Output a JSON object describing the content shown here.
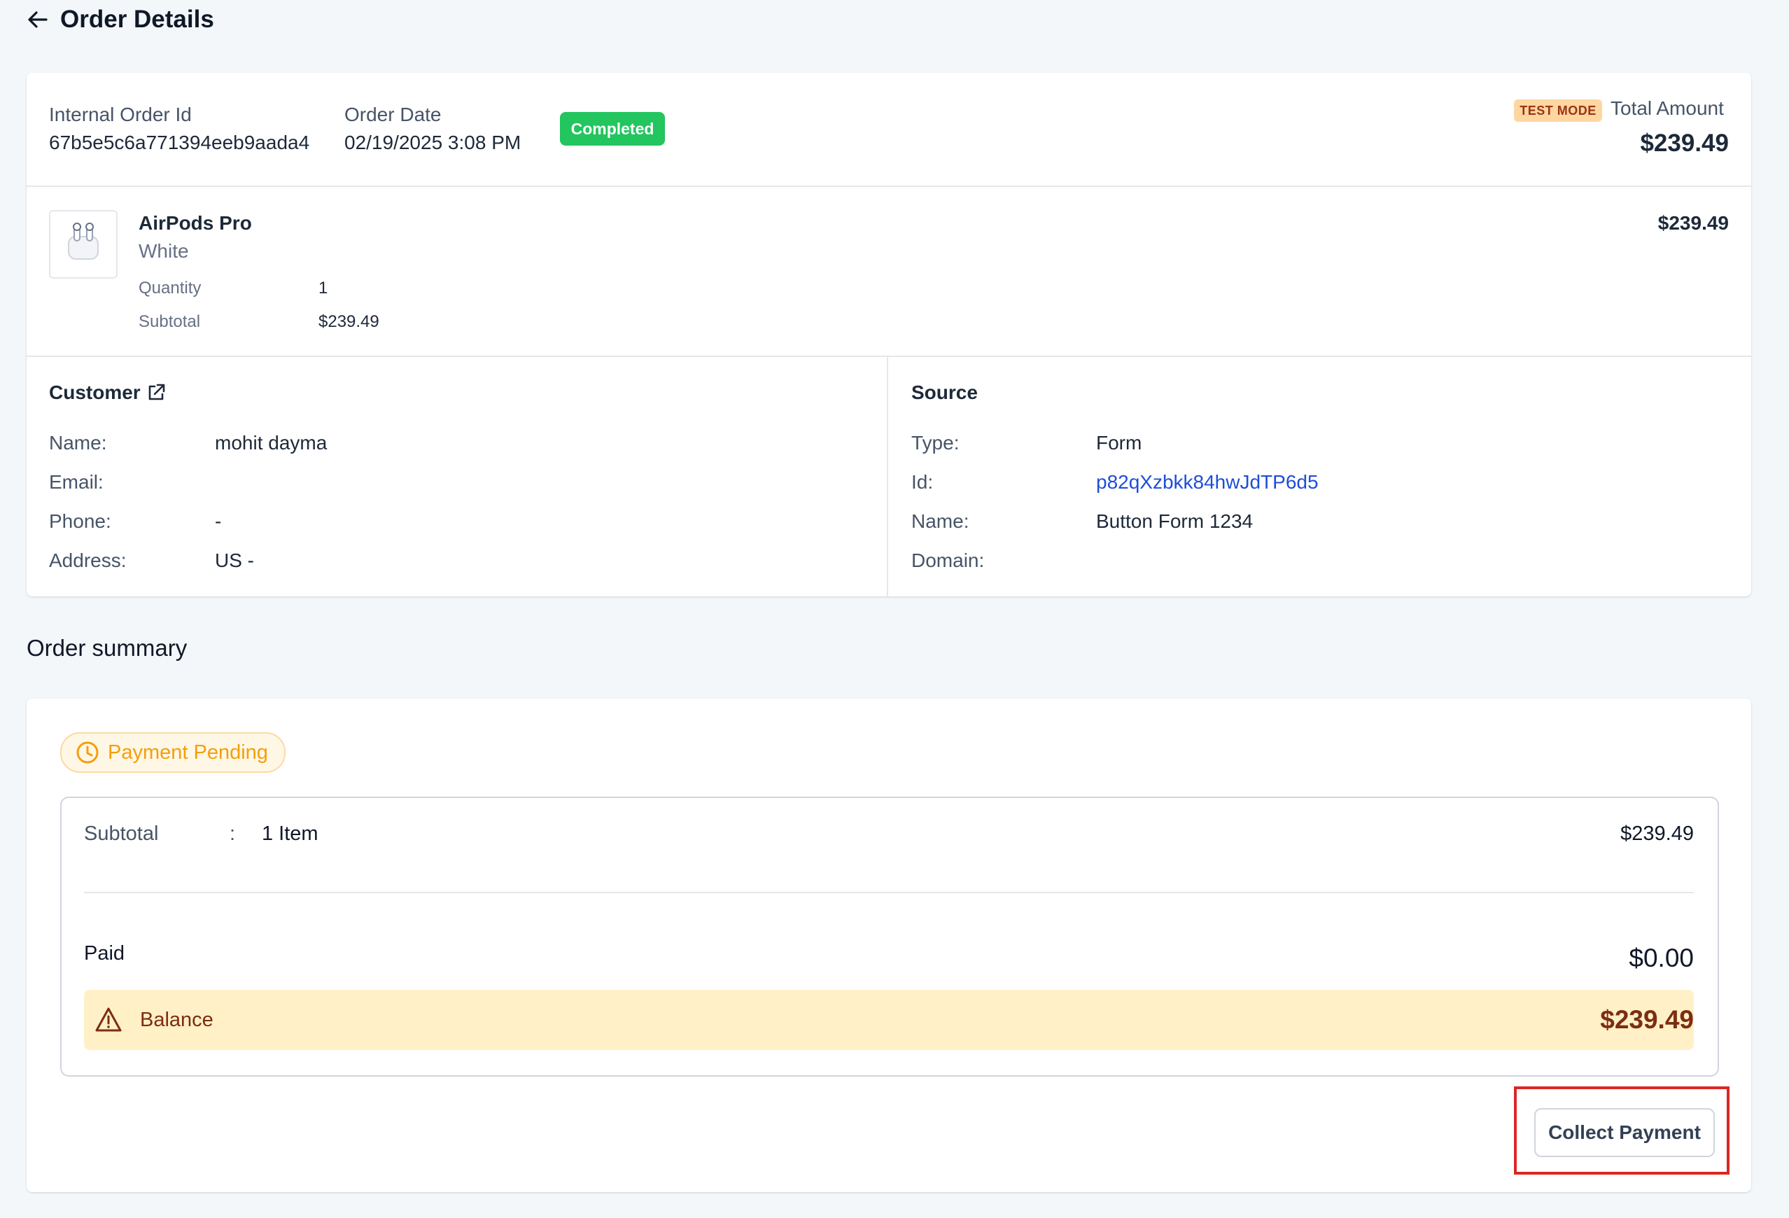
{
  "header": {
    "title": "Order Details"
  },
  "order": {
    "internal_id_label": "Internal Order Id",
    "internal_id": "67b5e5c6a771394eeb9aada4",
    "date_label": "Order Date",
    "date": "02/19/2025 3:08 PM",
    "status": "Completed",
    "test_mode": "TEST MODE",
    "total_label": "Total Amount",
    "total": "$239.49"
  },
  "item": {
    "name": "AirPods Pro",
    "variant": "White",
    "quantity_label": "Quantity",
    "quantity": "1",
    "subtotal_label": "Subtotal",
    "subtotal": "$239.49",
    "price": "$239.49"
  },
  "customer": {
    "heading": "Customer",
    "name_label": "Name:",
    "name": "mohit dayma",
    "email_label": "Email:",
    "email": "",
    "phone_label": "Phone:",
    "phone": "-",
    "address_label": "Address:",
    "address": "US -"
  },
  "source": {
    "heading": "Source",
    "type_label": "Type:",
    "type": "Form",
    "id_label": "Id:",
    "id": "p82qXzbkk84hwJdTP6d5",
    "name_label": "Name:",
    "name": "Button Form 1234",
    "domain_label": "Domain:",
    "domain": ""
  },
  "summary": {
    "title": "Order summary",
    "status_pill": "Payment Pending",
    "subtotal_label": "Subtotal",
    "subtotal_sep": ":",
    "subtotal_items": "1 Item",
    "subtotal_amount": "$239.49",
    "paid_label": "Paid",
    "paid_amount": "$0.00",
    "balance_label": "Balance",
    "balance_amount": "$239.49",
    "collect_button": "Collect Payment"
  },
  "colors": {
    "completed": "#22c55e",
    "pending": "#f59e0b",
    "balance_bg": "#fff0c7",
    "link": "#1d4ed8",
    "highlight": "#dc2626"
  }
}
